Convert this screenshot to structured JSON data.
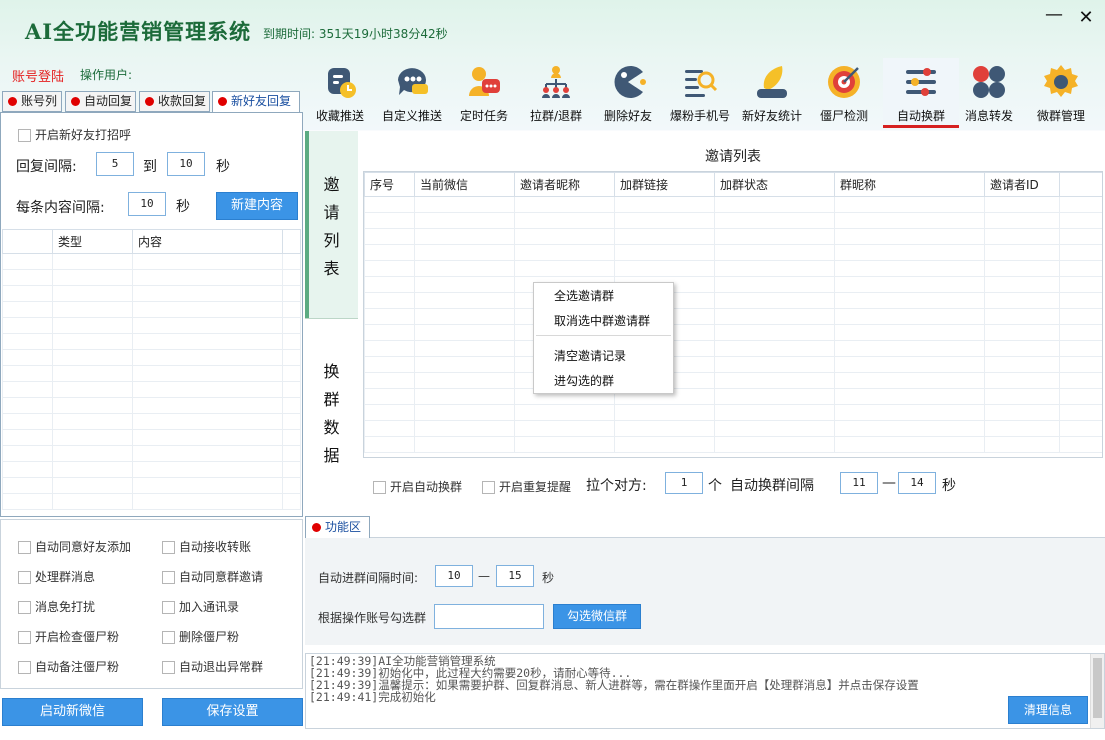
{
  "app": {
    "title": "AI全功能营销管理系统",
    "expire_label": "到期时间:",
    "expire_value": "351天19小时38分42秒",
    "minimize": "—",
    "close": "✕"
  },
  "account": {
    "login": "账号登陆",
    "operator": "操作用户:"
  },
  "toolbar": [
    {
      "label": "收藏推送",
      "icon": "collect-push-icon"
    },
    {
      "label": "自定义推送",
      "icon": "custom-push-icon"
    },
    {
      "label": "定时任务",
      "icon": "scheduled-task-icon"
    },
    {
      "label": "拉群/退群",
      "icon": "group-join-icon"
    },
    {
      "label": "删除好友",
      "icon": "delete-friend-icon"
    },
    {
      "label": "爆粉手机号",
      "icon": "phone-search-icon"
    },
    {
      "label": "新好友统计",
      "icon": "friend-stats-icon"
    },
    {
      "label": "僵尸检测",
      "icon": "zombie-detect-icon"
    },
    {
      "label": "自动换群",
      "icon": "auto-switch-group-icon"
    },
    {
      "label": "消息转发",
      "icon": "message-forward-icon"
    },
    {
      "label": "微群管理",
      "icon": "group-manage-icon"
    }
  ],
  "left_tabs": [
    "账号列",
    "自动回复",
    "收款回复",
    "新好友回复"
  ],
  "new_friend": {
    "enable_greeting": "开启新好友打招呼",
    "reply_interval_label": "回复间隔:",
    "reply_min": "5",
    "to": "到",
    "reply_max": "10",
    "seconds": "秒",
    "content_interval_label": "每条内容间隔:",
    "content_interval": "10",
    "content_seconds": "秒",
    "new_content_button": "新建内容",
    "columns": [
      "",
      "类型",
      "内容"
    ]
  },
  "options": [
    "自动同意好友添加",
    "自动接收转账",
    "处理群消息",
    "自动同意群邀请",
    "消息免打扰",
    "加入通讯录",
    "开启检查僵尸粉",
    "删除僵尸粉",
    "自动备注僵尸粉",
    "自动退出异常群"
  ],
  "bottom_buttons": {
    "start_wechat": "启动新微信",
    "save_settings": "保存设置"
  },
  "side_tabs": {
    "invite": [
      "邀",
      "请",
      "列",
      "表"
    ],
    "swap": [
      "换",
      "群",
      "数",
      "据"
    ]
  },
  "invite_list": {
    "caption": "邀请列表",
    "columns": [
      "序号",
      "当前微信",
      "邀请者昵称",
      "加群链接",
      "加群状态",
      "群昵称",
      "邀请者ID"
    ]
  },
  "context_menu": {
    "select_all": "全选邀请群",
    "deselect": "取消选中群邀请群",
    "clear_records": "清空邀请记录",
    "enter_checked": "进勾选的群"
  },
  "swap_settings": {
    "auto_swap": "开启自动换群",
    "repeat_remind": "开启重复提醒",
    "pull_label": "拉个对方:",
    "pull_count": "1",
    "unit": "个",
    "interval_label": "自动换群间隔",
    "interval_min": "11",
    "dash": "—",
    "interval_max": "14",
    "seconds": "秒"
  },
  "func_area": {
    "tab": "功能区",
    "join_interval_label": "自动进群间隔时间:",
    "join_min": "10",
    "dash": "—",
    "join_max": "15",
    "seconds": "秒",
    "select_label": "根据操作账号勾选群",
    "select_input": "",
    "select_button": "勾选微信群"
  },
  "log": {
    "lines": [
      "[21:49:39]AI全功能营销管理系统",
      "[21:49:39]初始化中，此过程大约需要20秒，请耐心等待...",
      "[21:49:39]温馨提示：如果需要护群、回复群消息、新人进群等，需在群操作里面开启【处理群消息】并点击保存设置",
      "[21:49:41]完成初始化"
    ],
    "clear_button": "清理信息"
  }
}
